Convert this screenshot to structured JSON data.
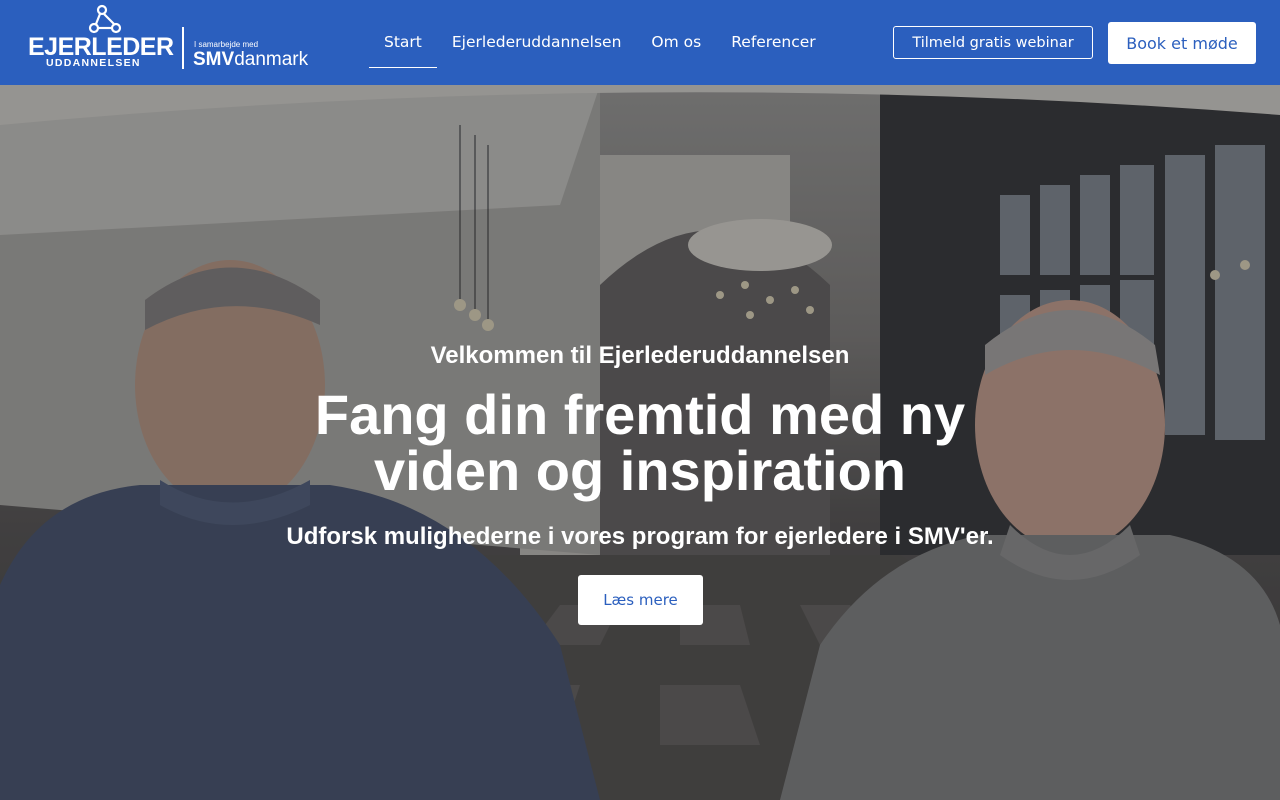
{
  "header": {
    "logo": {
      "main": "EJERLEDER",
      "sub": "UDDANNELSEN",
      "collab": "I samarbejde med",
      "partner_bold": "SMV",
      "partner_rest": "danmark"
    },
    "nav": [
      {
        "label": "Start",
        "active": true
      },
      {
        "label": "Ejerlederuddannelsen",
        "active": false
      },
      {
        "label": "Om os",
        "active": false
      },
      {
        "label": "Referencer",
        "active": false
      }
    ],
    "webinar_button": "Tilmeld gratis webinar",
    "meeting_button": "Book et møde"
  },
  "hero": {
    "kicker": "Velkommen til Ejerlederuddannelsen",
    "title": "Fang din fremtid med ny viden og inspiration",
    "subtitle": "Udforsk mulighederne i vores program for ejerledere i SMV'er.",
    "cta": "Læs mere"
  },
  "colors": {
    "brand_blue": "#2b5fbe",
    "text_on_brand": "#ffffff"
  },
  "icons": {
    "logo_mark": "network-nodes-icon"
  }
}
